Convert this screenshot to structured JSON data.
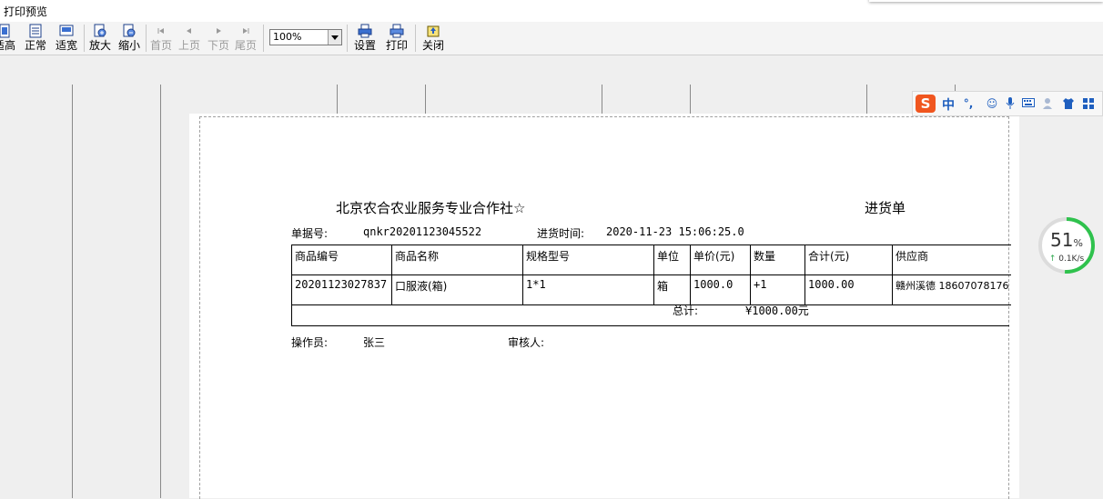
{
  "window": {
    "title": "打印预览"
  },
  "toolbar": {
    "fit_height": "适高",
    "normal": "正常",
    "fit_width": "适宽",
    "zoom_in": "放大",
    "zoom_out": "缩小",
    "first_page": "首页",
    "prev_page": "上页",
    "next_page": "下页",
    "last_page": "尾页",
    "zoom_value": "100%",
    "settings": "设置",
    "print": "打印",
    "close": "关闭"
  },
  "doc": {
    "company": "北京农合农业服务专业合作社☆",
    "doc_title": "进货单",
    "receipt_no_label": "单据号:",
    "receipt_no": "qnkr20201123045522",
    "time_label": "进货时间:",
    "time": "2020-11-23 15:06:25.0",
    "columns": [
      "商品编号",
      "商品名称",
      "规格型号",
      "单位",
      "单价(元)",
      "数量",
      "合计(元)",
      "供应商"
    ],
    "rows": [
      [
        "20201123027837",
        "口服液(箱)",
        "1*1",
        "箱",
        "1000.0",
        "+1",
        "1000.00",
        "赣州溪德 18607078176"
      ]
    ],
    "total_label": "总计:",
    "total_value": "¥1000.00元",
    "operator_label": "操作员:",
    "operator": "张三",
    "reviewer_label": "审核人:",
    "reviewer": ""
  },
  "ime": {
    "logo": "S",
    "mode": "中",
    "punct": "°,"
  },
  "net_monitor": {
    "percent": "51",
    "percent_unit": "%",
    "speed": "0.1K/s",
    "level": 0.51
  }
}
